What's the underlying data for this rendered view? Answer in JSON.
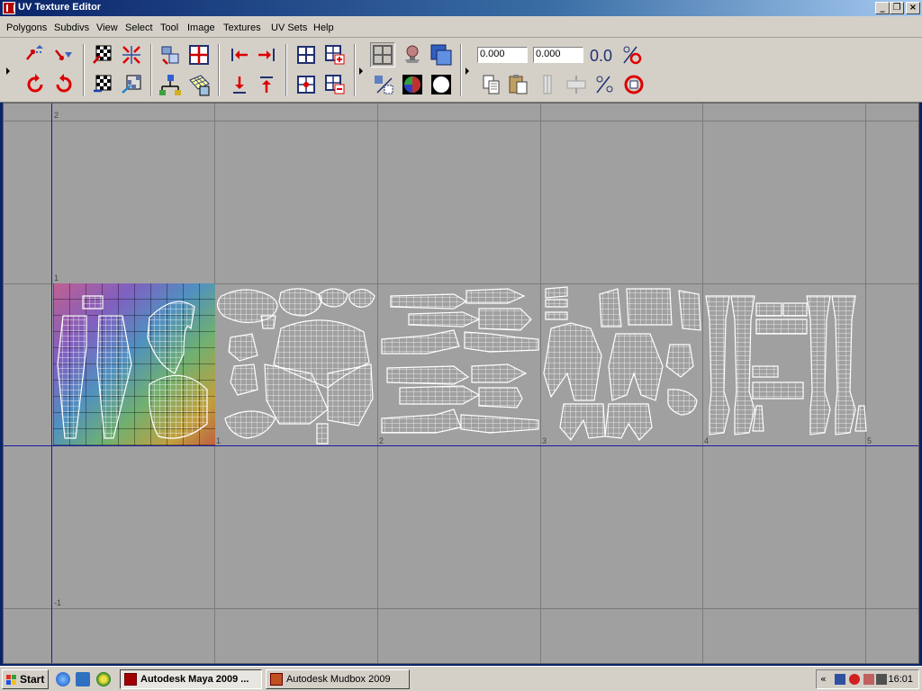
{
  "window": {
    "title": "UV Texture Editor"
  },
  "menubar": {
    "items": [
      "Polygons",
      "Subdivs",
      "View",
      "Select",
      "Tool",
      "Image",
      "Textures",
      "UV Sets",
      "Help"
    ]
  },
  "toolbar": {
    "u_value": "0.000",
    "v_value": "0.000",
    "precision_label": "0.0",
    "icons": [
      "flip-u",
      "flip-v",
      "map-uv-border",
      "cut-uvs",
      "move-uv-shell",
      "layout",
      "move-left",
      "move-right",
      "grid-uvs",
      "isolate-select",
      "toggle-grid",
      "display-image",
      "filter-image",
      "rotate-ccw",
      "rotate-cw",
      "checker-map",
      "checker-map-2",
      "sew-uvs",
      "straighten",
      "move-down",
      "move-up",
      "add-isolate",
      "remove-isolate",
      "shaded-uv",
      "texture-borders",
      "dim-image",
      "copy-uvs",
      "paste-uvs",
      "paste-u",
      "paste-v",
      "swap-uvs",
      "cycle-uv"
    ]
  },
  "viewport": {
    "labels": {
      "v2": "2",
      "v1": "1",
      "vm1": "-1",
      "u1": "1",
      "u2": "2",
      "u3": "3",
      "u4": "4",
      "u5": "5"
    }
  },
  "taskbar": {
    "start_label": "Start",
    "tasks": [
      {
        "label": "Autodesk Maya 2009 ...",
        "active": true
      },
      {
        "label": "Autodesk Mudbox 2009",
        "active": false
      }
    ],
    "clock": "16:01",
    "tray_chevron": "«"
  }
}
